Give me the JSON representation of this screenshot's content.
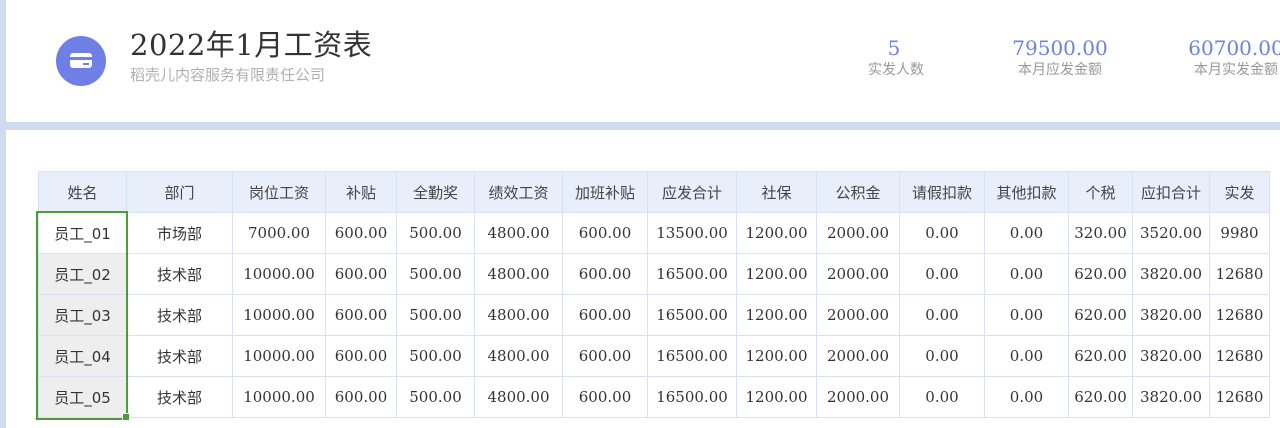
{
  "header": {
    "title": "2022年1月工资表",
    "company": "稻壳儿内容服务有限责任公司",
    "logo_icon": "credit-card-icon",
    "accent": "#6f7fe6"
  },
  "stats": [
    {
      "value": "5",
      "label": "实发人数"
    },
    {
      "value": "79500.00",
      "label": "本月应发金额"
    },
    {
      "value": "60700.00",
      "label": "本月实发金额"
    }
  ],
  "table": {
    "columns": [
      "姓名",
      "部门",
      "岗位工资",
      "补贴",
      "全勤奖",
      "绩效工资",
      "加班补贴",
      "应发合计",
      "社保",
      "公积金",
      "请假扣款",
      "其他扣款",
      "个税",
      "应扣合计",
      "实发"
    ],
    "rows": [
      [
        "员工_01",
        "市场部",
        "7000.00",
        "600.00",
        "500.00",
        "4800.00",
        "600.00",
        "13500.00",
        "1200.00",
        "2000.00",
        "0.00",
        "0.00",
        "320.00",
        "3520.00",
        "9980"
      ],
      [
        "员工_02",
        "技术部",
        "10000.00",
        "600.00",
        "500.00",
        "4800.00",
        "600.00",
        "16500.00",
        "1200.00",
        "2000.00",
        "0.00",
        "0.00",
        "620.00",
        "3820.00",
        "12680"
      ],
      [
        "员工_03",
        "技术部",
        "10000.00",
        "600.00",
        "500.00",
        "4800.00",
        "600.00",
        "16500.00",
        "1200.00",
        "2000.00",
        "0.00",
        "0.00",
        "620.00",
        "3820.00",
        "12680"
      ],
      [
        "员工_04",
        "技术部",
        "10000.00",
        "600.00",
        "500.00",
        "4800.00",
        "600.00",
        "16500.00",
        "1200.00",
        "2000.00",
        "0.00",
        "0.00",
        "620.00",
        "3820.00",
        "12680"
      ],
      [
        "员工_05",
        "技术部",
        "10000.00",
        "600.00",
        "500.00",
        "4800.00",
        "600.00",
        "16500.00",
        "1200.00",
        "2000.00",
        "0.00",
        "0.00",
        "620.00",
        "3820.00",
        "12680"
      ]
    ],
    "selection_color": "#4f9b3a"
  }
}
